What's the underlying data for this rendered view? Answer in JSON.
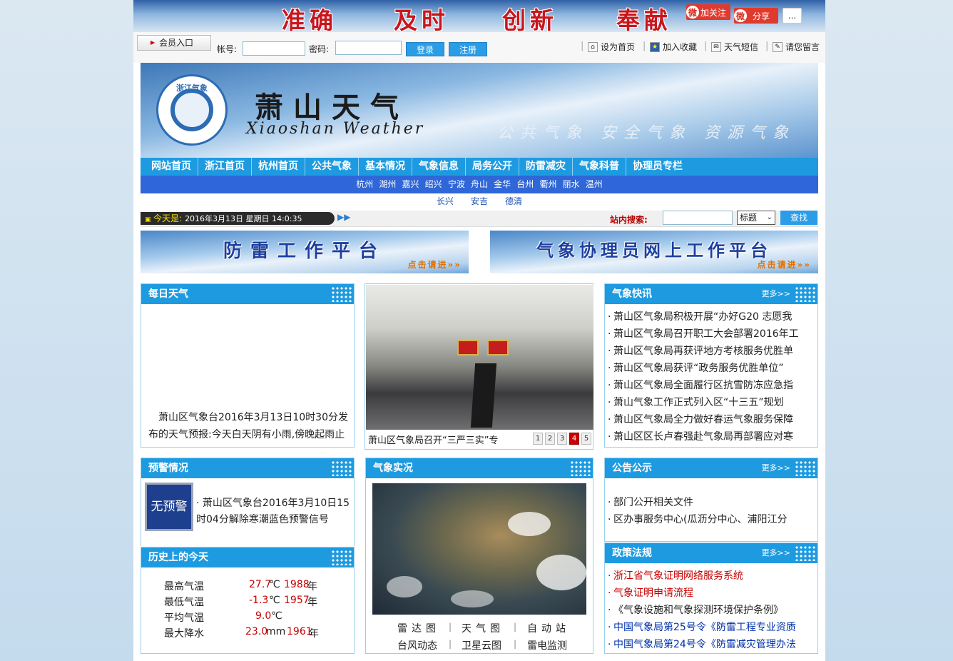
{
  "banner": {
    "slogans": [
      "准确",
      "及时",
      "创新",
      "奉献"
    ],
    "follow_label": "加关注",
    "share_label": "分享",
    "more_label": "..."
  },
  "login": {
    "member_label": "会员入口",
    "account_label": "帐号:",
    "password_label": "密码:",
    "login_btn": "登录",
    "register_btn": "注册"
  },
  "toplinks": [
    "设为首页",
    "加入收藏",
    "天气短信",
    "请您留言"
  ],
  "header": {
    "logo_text": "浙江气象",
    "title_cn": "萧山天气",
    "title_en": "Xiaoshan Weather",
    "motto": "公共气象 安全气象 资源气象"
  },
  "nav": [
    "网站首页",
    "浙江首页",
    "杭州首页",
    "公共气象",
    "基本情况",
    "气象信息",
    "局务公开",
    "防雷减灾",
    "气象科普",
    "协理员专栏"
  ],
  "cities": [
    "杭州",
    "湖州",
    "嘉兴",
    "绍兴",
    "宁波",
    "舟山",
    "金华",
    "台州",
    "衢州",
    "丽水",
    "温州"
  ],
  "subcities": [
    "长兴",
    "安吉",
    "德清"
  ],
  "datebar": {
    "today_label": "今天是:",
    "datetime": "2016年3月13日 星期日 14:0:35",
    "search_label": "站内搜索:",
    "search_option": "标题",
    "search_btn": "查找"
  },
  "platforms": [
    {
      "title": "防雷工作平台",
      "cta": "点击请进"
    },
    {
      "title": "气象协理员网上工作平台",
      "cta": "点击请进"
    }
  ],
  "daily_weather": {
    "title": "每日天气",
    "text": "萧山区气象台2016年3月13日10时30分发布的天气预报:今天白天阴有小雨,傍晚起雨止"
  },
  "photo_news": {
    "caption": "萧山区气象局召开“三严三实”专",
    "pages": [
      "1",
      "2",
      "3",
      "4",
      "5"
    ],
    "active_page": "4"
  },
  "quick_news": {
    "title": "气象快讯",
    "more": "更多>>",
    "items": [
      "萧山区气象局积极开展“办好G20 志愿我",
      "萧山区气象局召开职工大会部署2016年工",
      "萧山区气象局再获评地方考核服务优胜单",
      "萧山区气象局获评“政务服务优胜单位”",
      "萧山区气象局全面履行区抗雪防冻应急指",
      "萧山气象工作正式列入区“十三五”规划",
      "萧山区气象局全力做好春运气象服务保障",
      "萧山区区长卢春强赴气象局再部署应对寒"
    ]
  },
  "warning": {
    "title": "预警情况",
    "badge": "无预警",
    "text": "萧山区气象台2016年3月10日15时04分解除寒潮蓝色预警信号"
  },
  "history": {
    "title": "历史上的今天",
    "rows": [
      {
        "label": "最高气温",
        "value": "27.7",
        "unit": "℃",
        "year": "1988",
        "suffix": "年"
      },
      {
        "label": "最低气温",
        "value": "-1.3",
        "unit": "℃",
        "year": "1957",
        "suffix": "年"
      },
      {
        "label": "平均气温",
        "value": "9.0",
        "unit": "℃",
        "year": "",
        "suffix": ""
      },
      {
        "label": "最大降水",
        "value": "23.0",
        "unit": "mm",
        "year": "1961",
        "suffix": "年"
      }
    ]
  },
  "live": {
    "title": "气象实况",
    "links": [
      "雷达图",
      "天气图",
      "自动站",
      "台风动态",
      "卫星云图",
      "雷电监测"
    ]
  },
  "notice": {
    "title": "公告公示",
    "more": "更多>>",
    "items": [
      "部门公开相关文件",
      "区办事服务中心(瓜沥分中心、浦阳江分"
    ]
  },
  "policy": {
    "title": "政策法规",
    "more": "更多>>",
    "items": [
      "浙江省气象证明网络服务系统",
      "气象证明申请流程",
      "《气象设施和气象探测环境保护条例》",
      "中国气象局第25号令《防雷工程专业资质",
      "中国气象局第24号令《防雷减灾管理办法"
    ]
  },
  "colors": {
    "nav_blue": "#1e9be0",
    "city_blue": "#2f66d8",
    "warning_red": "#c80000",
    "link_blue": "#0030a8"
  }
}
